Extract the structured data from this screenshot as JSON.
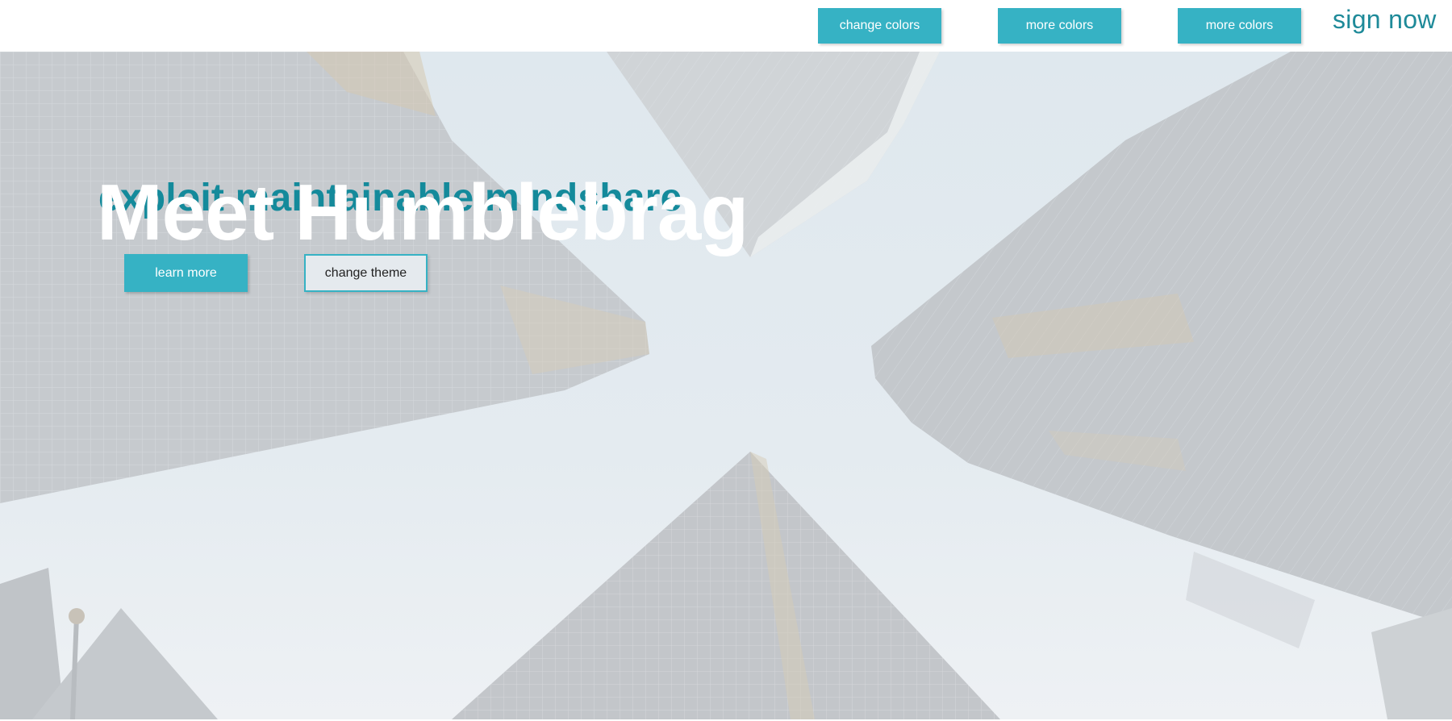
{
  "nav": {
    "buttons": [
      {
        "label": "change colors"
      },
      {
        "label": "more colors"
      },
      {
        "label": "more colors"
      }
    ],
    "sign_now": "sign now"
  },
  "hero": {
    "eyebrow": "exploit maintainable mindshare",
    "headline": "Meet Humblebrag",
    "primary_cta": "learn more",
    "secondary_cta": "change theme",
    "background": "skyscrapers-looking-up-photo"
  },
  "colors": {
    "accent": "#36b2c4",
    "accent_dark": "#148a9b",
    "headline": "#ffffff"
  }
}
